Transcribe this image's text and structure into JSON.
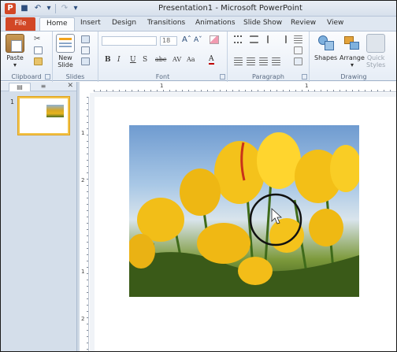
{
  "window": {
    "title": "Presentation1 - Microsoft PowerPoint",
    "app_icon_letter": "P"
  },
  "tabs": {
    "file": "File",
    "items": [
      "Home",
      "Insert",
      "Design",
      "Transitions",
      "Animations",
      "Slide Show",
      "Review",
      "View"
    ],
    "active": "Home"
  },
  "ribbon": {
    "clipboard": {
      "label": "Clipboard",
      "paste": "Paste"
    },
    "slides": {
      "label": "Slides",
      "new_slide_1": "New",
      "new_slide_2": "Slide"
    },
    "font": {
      "label": "Font",
      "font_name": "",
      "font_size": "18"
    },
    "paragraph": {
      "label": "Paragraph"
    },
    "drawing": {
      "label": "Drawing",
      "shapes": "Shapes",
      "arrange": "Arrange",
      "quick_styles_1": "Quick",
      "quick_styles_2": "Styles"
    }
  },
  "slides_pane": {
    "slide_number": "1"
  },
  "rulers": {
    "h_numbers": [
      "1",
      "1"
    ],
    "v_numbers": [
      "1",
      "2",
      "1",
      "2"
    ]
  },
  "colors": {
    "file_tab": "#d24726",
    "selection": "#f2c34a",
    "ribbon_bg": "#e6edf6"
  }
}
